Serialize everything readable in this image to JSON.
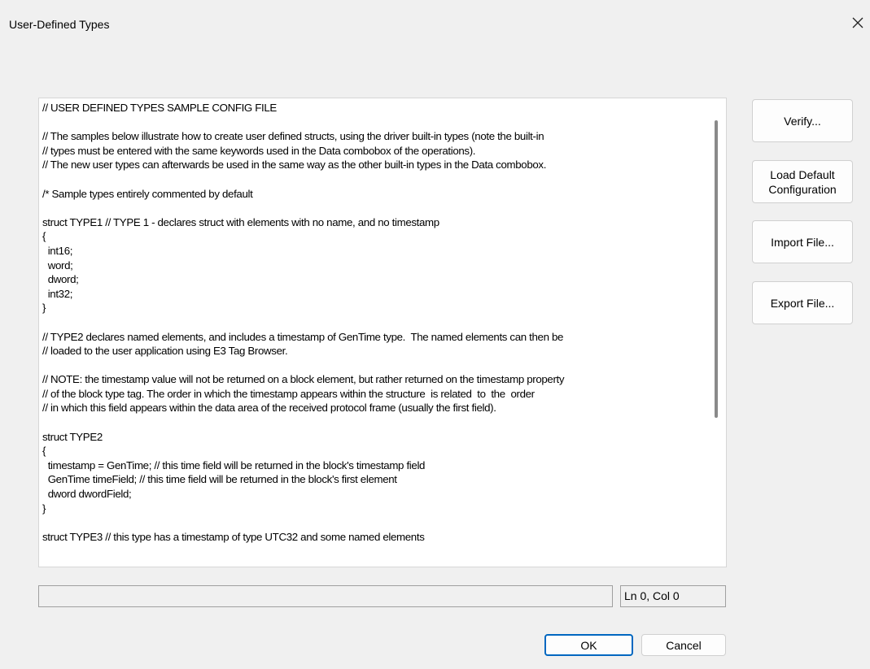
{
  "window": {
    "title": "User-Defined Types",
    "close_icon": "close-icon"
  },
  "editor": {
    "text": "// USER DEFINED TYPES SAMPLE CONFIG FILE\n\n// The samples below illustrate how to create user defined structs, using the driver built-in types (note the built-in\n// types must be entered with the same keywords used in the Data combobox of the operations).\n// The new user types can afterwards be used in the same way as the other built-in types in the Data combobox.\n\n/* Sample types entirely commented by default\n\nstruct TYPE1 // TYPE 1 - declares struct with elements with no name, and no timestamp\n{\n  int16;\n  word;\n  dword;\n  int32;\n}\n\n// TYPE2 declares named elements, and includes a timestamp of GenTime type.  The named elements can then be\n// loaded to the user application using E3 Tag Browser.\n\n// NOTE: the timestamp value will not be returned on a block element, but rather returned on the timestamp property\n// of the block type tag. The order in which the timestamp appears within the structure  is related  to  the  order\n// in which this field appears within the data area of the received protocol frame (usually the first field).\n\nstruct TYPE2\n{\n  timestamp = GenTime; // this time field will be returned in the block's timestamp field\n  GenTime timeField; // this time field will be returned in the block's first element\n  dword dwordField;\n}\n\nstruct TYPE3 // this type has a timestamp of type UTC32 and some named elements"
  },
  "side_buttons": {
    "verify": "Verify...",
    "load_default": "Load Default\nConfiguration",
    "import_file": "Import File...",
    "export_file": "Export File..."
  },
  "status": {
    "message": "",
    "position": "Ln 0, Col 0"
  },
  "footer": {
    "ok": "OK",
    "cancel": "Cancel"
  },
  "colors": {
    "dialog_bg": "#f0f0f0",
    "editor_bg": "#ffffff",
    "default_button_border": "#0067c0"
  }
}
